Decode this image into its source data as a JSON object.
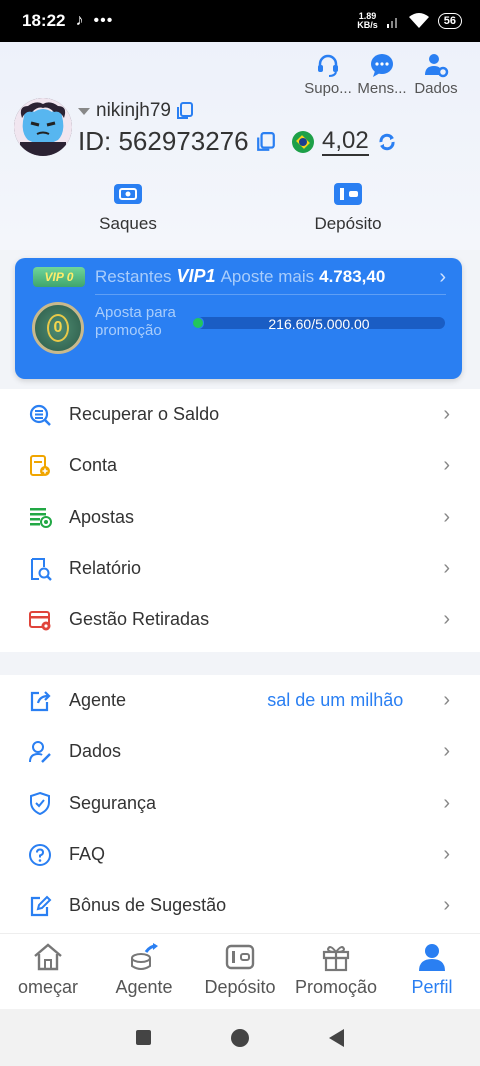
{
  "status_bar": {
    "time": "18:22",
    "net_speed_value": "1.89",
    "net_speed_unit": "KB/s",
    "battery": "56",
    "icons": [
      "tiktok-icon",
      "more-dots-icon",
      "signal-icon",
      "wifi-icon",
      "battery-icon"
    ]
  },
  "header": {
    "top_actions": [
      {
        "label": "Supo...",
        "icon": "headset-icon"
      },
      {
        "label": "Mens...",
        "icon": "chat-icon"
      },
      {
        "label": "Dados",
        "icon": "user-gear-icon"
      }
    ],
    "username": "nikinjh79",
    "user_id": "ID: 562973276",
    "balance": "4,02",
    "quick_actions": [
      {
        "label": "Saques",
        "icon": "wallet-withdraw-icon"
      },
      {
        "label": "Depósito",
        "icon": "wallet-deposit-icon"
      }
    ]
  },
  "vip": {
    "badge": "VIP 0",
    "remaining_label": "Restantes",
    "level": "VIP1",
    "bet_more_label": "Aposte mais",
    "amount": "4.783,40",
    "promo_label": "Aposta para promoção",
    "medal_value": "0",
    "progress_text": "216.60/5.000.00",
    "progress_fraction": 0.0433
  },
  "menu_group_1": [
    {
      "label": "Recuperar o Saldo",
      "icon": "recover-balance-icon"
    },
    {
      "label": "Conta",
      "icon": "account-icon"
    },
    {
      "label": "Apostas",
      "icon": "bets-icon"
    },
    {
      "label": "Relatório",
      "icon": "report-icon"
    },
    {
      "label": "Gestão Retiradas",
      "icon": "withdraw-management-icon"
    }
  ],
  "menu_group_2": [
    {
      "label": "Agente",
      "icon": "agent-share-icon",
      "marquee": "sal de um milhão"
    },
    {
      "label": "Dados",
      "icon": "user-edit-icon"
    },
    {
      "label": "Segurança",
      "icon": "shield-icon"
    },
    {
      "label": "FAQ",
      "icon": "question-icon"
    },
    {
      "label": "Bônus de Sugestão",
      "icon": "suggestion-edit-icon"
    }
  ],
  "tabbar": [
    {
      "label": "omeçar",
      "icon": "home-icon"
    },
    {
      "label": "Agente",
      "icon": "agent-coins-icon"
    },
    {
      "label": "Depósito",
      "icon": "deposit-wallet-icon"
    },
    {
      "label": "Promoção",
      "icon": "gift-icon"
    },
    {
      "label": "Perfil",
      "icon": "profile-icon",
      "active": true
    }
  ],
  "colors": {
    "accent": "#2a7ff2",
    "vip_card": "#2a7ff2",
    "progress_dot": "#22c55e"
  }
}
